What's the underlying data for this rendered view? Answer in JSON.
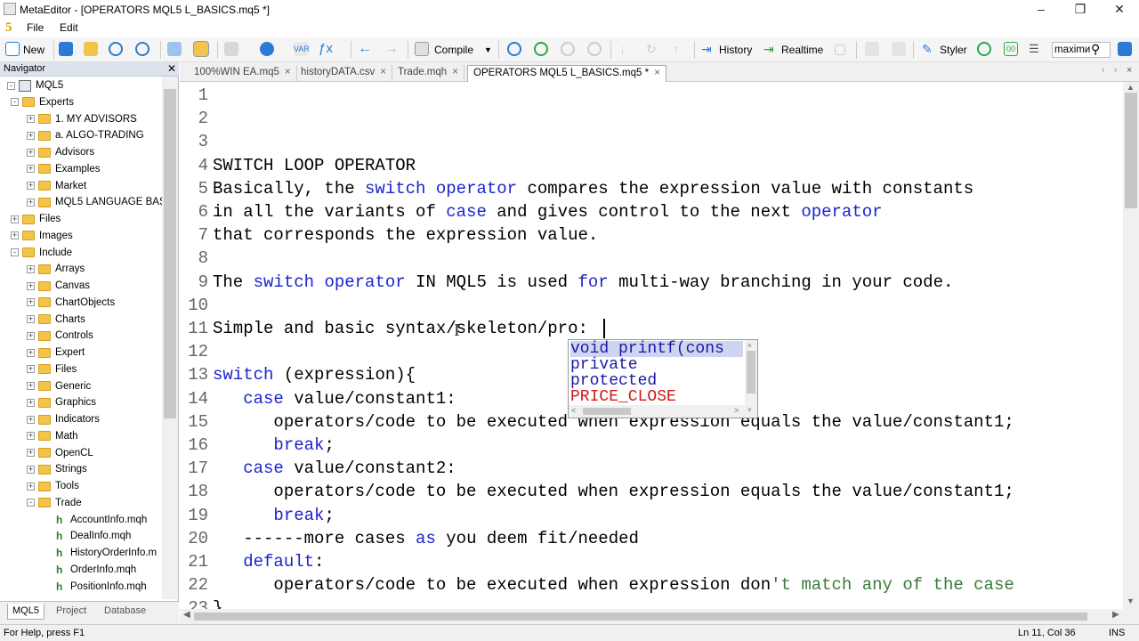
{
  "window": {
    "title": "MetaEditor - [OPERATORS MQL5 L_BASICS.mq5 *]",
    "logo": "5"
  },
  "menu": {
    "items": [
      "File",
      "Edit"
    ]
  },
  "toolbar": {
    "new": "New",
    "compile": "Compile",
    "history": "History",
    "realtime": "Realtime",
    "styler": "Styler",
    "search_value": "maximи"
  },
  "navigator": {
    "title": "Navigator",
    "rows": [
      {
        "type": "root",
        "label": "MQL5",
        "indent": 0,
        "exp": "-"
      },
      {
        "type": "folder",
        "label": "Experts",
        "indent": 1,
        "exp": "-"
      },
      {
        "type": "folder",
        "label": "1. MY ADVISORS",
        "indent": 2,
        "exp": "+"
      },
      {
        "type": "folder",
        "label": "a. ALGO-TRADING",
        "indent": 2,
        "exp": "+"
      },
      {
        "type": "folder",
        "label": "Advisors",
        "indent": 2,
        "exp": "+"
      },
      {
        "type": "folder",
        "label": "Examples",
        "indent": 2,
        "exp": "+"
      },
      {
        "type": "folder",
        "label": "Market",
        "indent": 2,
        "exp": "+"
      },
      {
        "type": "folder",
        "label": "MQL5 LANGUAGE BAS",
        "indent": 2,
        "exp": "+"
      },
      {
        "type": "folder",
        "label": "Files",
        "indent": 1,
        "exp": "+"
      },
      {
        "type": "folder",
        "label": "Images",
        "indent": 1,
        "exp": "+"
      },
      {
        "type": "folder",
        "label": "Include",
        "indent": 1,
        "exp": "-"
      },
      {
        "type": "folder",
        "label": "Arrays",
        "indent": 2,
        "exp": "+"
      },
      {
        "type": "folder",
        "label": "Canvas",
        "indent": 2,
        "exp": "+"
      },
      {
        "type": "folder",
        "label": "ChartObjects",
        "indent": 2,
        "exp": "+"
      },
      {
        "type": "folder",
        "label": "Charts",
        "indent": 2,
        "exp": "+"
      },
      {
        "type": "folder",
        "label": "Controls",
        "indent": 2,
        "exp": "+"
      },
      {
        "type": "folder",
        "label": "Expert",
        "indent": 2,
        "exp": "+"
      },
      {
        "type": "folder",
        "label": "Files",
        "indent": 2,
        "exp": "+"
      },
      {
        "type": "folder",
        "label": "Generic",
        "indent": 2,
        "exp": "+"
      },
      {
        "type": "folder",
        "label": "Graphics",
        "indent": 2,
        "exp": "+"
      },
      {
        "type": "folder",
        "label": "Indicators",
        "indent": 2,
        "exp": "+"
      },
      {
        "type": "folder",
        "label": "Math",
        "indent": 2,
        "exp": "+"
      },
      {
        "type": "folder",
        "label": "OpenCL",
        "indent": 2,
        "exp": "+"
      },
      {
        "type": "folder",
        "label": "Strings",
        "indent": 2,
        "exp": "+"
      },
      {
        "type": "folder",
        "label": "Tools",
        "indent": 2,
        "exp": "+"
      },
      {
        "type": "folder",
        "label": "Trade",
        "indent": 2,
        "exp": "-"
      },
      {
        "type": "file",
        "label": "AccountInfo.mqh",
        "indent": 3,
        "exp": ""
      },
      {
        "type": "file",
        "label": "DealInfo.mqh",
        "indent": 3,
        "exp": ""
      },
      {
        "type": "file",
        "label": "HistoryOrderInfo.m",
        "indent": 3,
        "exp": ""
      },
      {
        "type": "file",
        "label": "OrderInfo.mqh",
        "indent": 3,
        "exp": ""
      },
      {
        "type": "file",
        "label": "PositionInfo.mqh",
        "indent": 3,
        "exp": ""
      }
    ],
    "tabs": [
      "MQL5",
      "Project",
      "Database"
    ]
  },
  "file_tabs": [
    {
      "label": "100%WIN EA.mq5",
      "active": false
    },
    {
      "label": "historyDATA.csv",
      "active": false
    },
    {
      "label": "Trade.mqh",
      "active": false
    },
    {
      "label": "OPERATORS MQL5 L_BASICS.mq5 *",
      "active": true
    }
  ],
  "code_lines": [
    {
      "n": "1",
      "segs": []
    },
    {
      "n": "2",
      "segs": []
    },
    {
      "n": "3",
      "segs": []
    },
    {
      "n": "4",
      "segs": [
        [
          "SWITCH LOOP OPERATOR",
          ""
        ]
      ]
    },
    {
      "n": "5",
      "segs": [
        [
          "Basically, the ",
          ""
        ],
        [
          "switch",
          "kw"
        ],
        [
          " ",
          ""
        ],
        [
          "operator",
          "kw"
        ],
        [
          " compares the expression value with constants",
          ""
        ]
      ]
    },
    {
      "n": "6",
      "segs": [
        [
          "in all the variants of ",
          ""
        ],
        [
          "case",
          "kw"
        ],
        [
          " and gives control to the next ",
          ""
        ],
        [
          "operator",
          "kw"
        ]
      ]
    },
    {
      "n": "7",
      "segs": [
        [
          "that corresponds the expression value.",
          ""
        ]
      ]
    },
    {
      "n": "8",
      "segs": []
    },
    {
      "n": "9",
      "segs": [
        [
          "The ",
          ""
        ],
        [
          "switch",
          "kw"
        ],
        [
          " ",
          ""
        ],
        [
          "operator",
          "kw"
        ],
        [
          " IN MQL5 is used ",
          ""
        ],
        [
          "for",
          "kw"
        ],
        [
          " multi-way branching in your code.",
          ""
        ]
      ]
    },
    {
      "n": "10",
      "segs": []
    },
    {
      "n": "11",
      "segs": [
        [
          "Simple and basic syntax/skeleton/pro:",
          ""
        ]
      ]
    },
    {
      "n": "12",
      "segs": []
    },
    {
      "n": "13",
      "segs": [
        [
          "switch",
          "kw"
        ],
        [
          " (expression){",
          ""
        ]
      ]
    },
    {
      "n": "14",
      "segs": [
        [
          "   ",
          ""
        ],
        [
          "case",
          "kw"
        ],
        [
          " value/constant1:",
          ""
        ]
      ]
    },
    {
      "n": "15",
      "segs": [
        [
          "      operators/code to be executed when expression equals the value/constant1;",
          ""
        ]
      ]
    },
    {
      "n": "16",
      "segs": [
        [
          "      ",
          ""
        ],
        [
          "break",
          "kw"
        ],
        [
          ";",
          ""
        ]
      ]
    },
    {
      "n": "17",
      "segs": [
        [
          "   ",
          ""
        ],
        [
          "case",
          "kw"
        ],
        [
          " value/constant2:",
          ""
        ]
      ]
    },
    {
      "n": "18",
      "segs": [
        [
          "      operators/code to be executed when expression equals the value/constant1;",
          ""
        ]
      ]
    },
    {
      "n": "19",
      "segs": [
        [
          "      ",
          ""
        ],
        [
          "break",
          "kw"
        ],
        [
          ";",
          ""
        ]
      ]
    },
    {
      "n": "20",
      "segs": [
        [
          "   ------more cases ",
          ""
        ],
        [
          "as",
          "kw"
        ],
        [
          " you deem fit/needed",
          ""
        ]
      ]
    },
    {
      "n": "21",
      "segs": [
        [
          "   ",
          ""
        ],
        [
          "default",
          "kw"
        ],
        [
          ":",
          ""
        ]
      ]
    },
    {
      "n": "22",
      "segs": [
        [
          "      operators/code to be executed when expression don",
          ""
        ],
        [
          "'t match any of the case",
          "str"
        ]
      ]
    },
    {
      "n": "23",
      "segs": [
        [
          "}",
          ""
        ]
      ]
    }
  ],
  "autocomplete": {
    "items": [
      {
        "text": "void printf(cons",
        "color": "#1a1aa6",
        "bg": "#cfd4f0"
      },
      {
        "text": "private",
        "color": "#1a1aa6",
        "bg": ""
      },
      {
        "text": "protected",
        "color": "#1a1aa6",
        "bg": ""
      },
      {
        "text": "PRICE_CLOSE",
        "color": "#d01818",
        "bg": ""
      }
    ]
  },
  "status": {
    "help": "For Help, press F1",
    "position": "Ln 11, Col 36",
    "mode": "INS"
  }
}
